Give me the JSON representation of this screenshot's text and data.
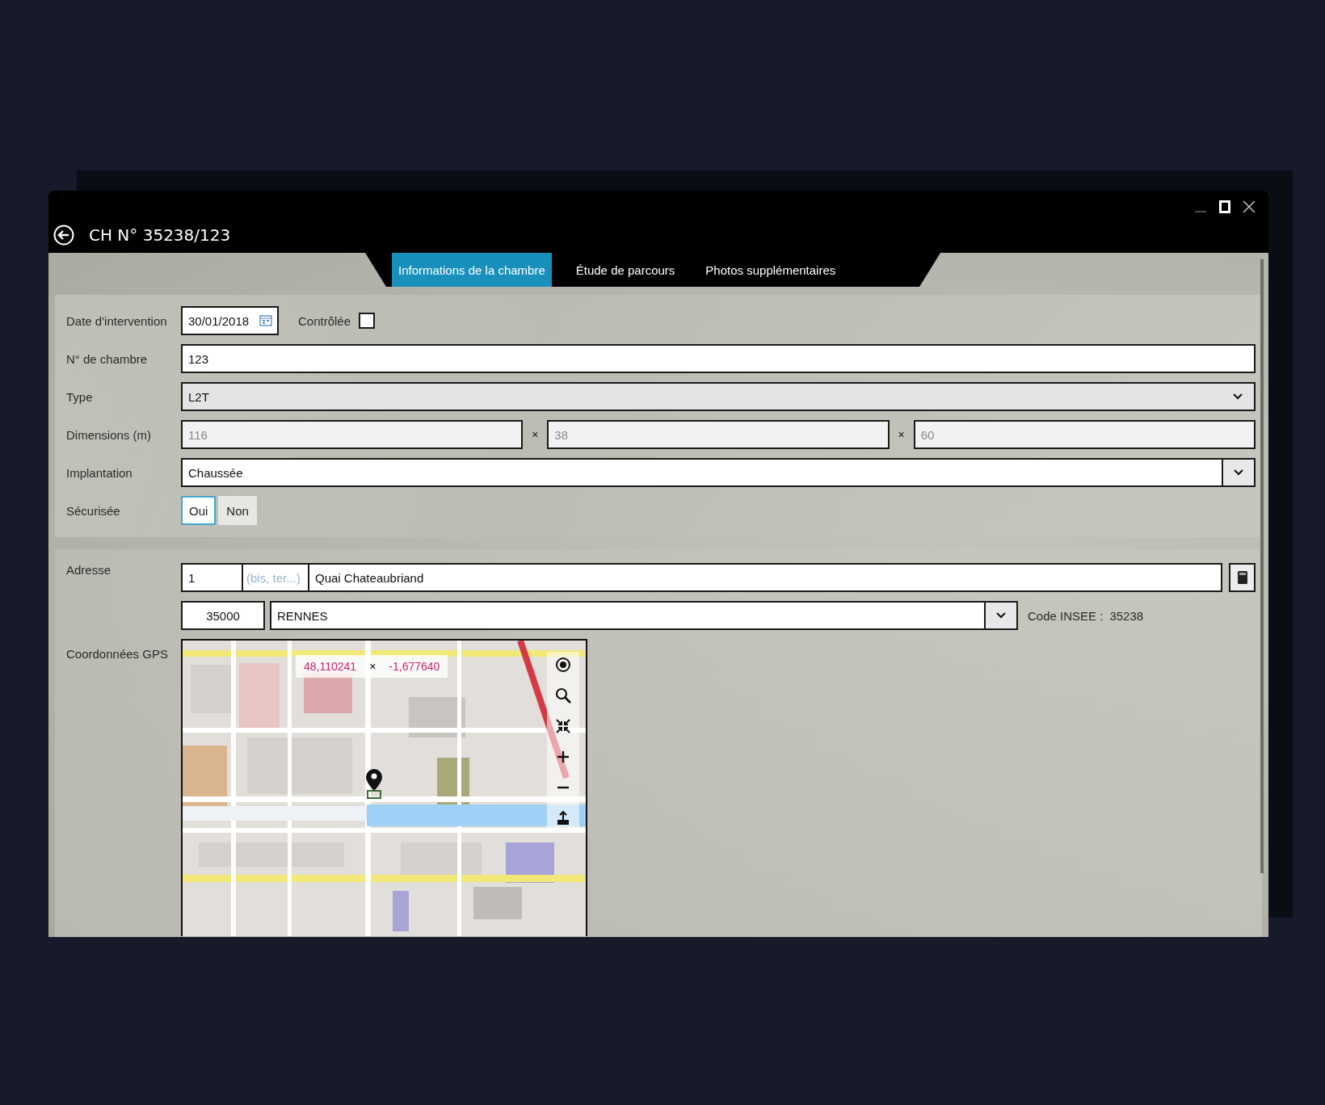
{
  "window": {
    "title": "CH N° 35238/123"
  },
  "tabs": [
    {
      "label": "Informations de la chambre",
      "selected": true
    },
    {
      "label": "Étude de parcours",
      "selected": false
    },
    {
      "label": "Photos supplémentaires",
      "selected": false
    }
  ],
  "form": {
    "date": {
      "label": "Date d'intervention",
      "value": "30/01/2018"
    },
    "controlled": {
      "label": "Contrôlée",
      "checked": false
    },
    "chamber_number": {
      "label": "N° de chambre",
      "value": "123"
    },
    "type": {
      "label": "Type",
      "value": "L2T",
      "disabled": true
    },
    "dimensions": {
      "label": "Dimensions (m)",
      "values": [
        "116",
        "38",
        "60"
      ],
      "separators": [
        "×",
        "×"
      ],
      "disabled": true
    },
    "implantation": {
      "label": "Implantation",
      "value": "Chaussée"
    },
    "secured": {
      "label": "Sécurisée",
      "options": [
        {
          "label": "Oui",
          "selected": true
        },
        {
          "label": "Non",
          "selected": false
        }
      ]
    }
  },
  "address": {
    "label": "Adresse",
    "number": "1",
    "suffix": {
      "placeholder": "(bis, ter...)"
    },
    "street": "Quai Chateaubriand",
    "postcode": "35000",
    "city": "RENNES",
    "insee_label": "Code INSEE :",
    "insee_value": "35238"
  },
  "gps": {
    "label": "Coordonnées GPS",
    "latitude": "48,110241",
    "separator": "×",
    "longitude": "-1,677640"
  }
}
